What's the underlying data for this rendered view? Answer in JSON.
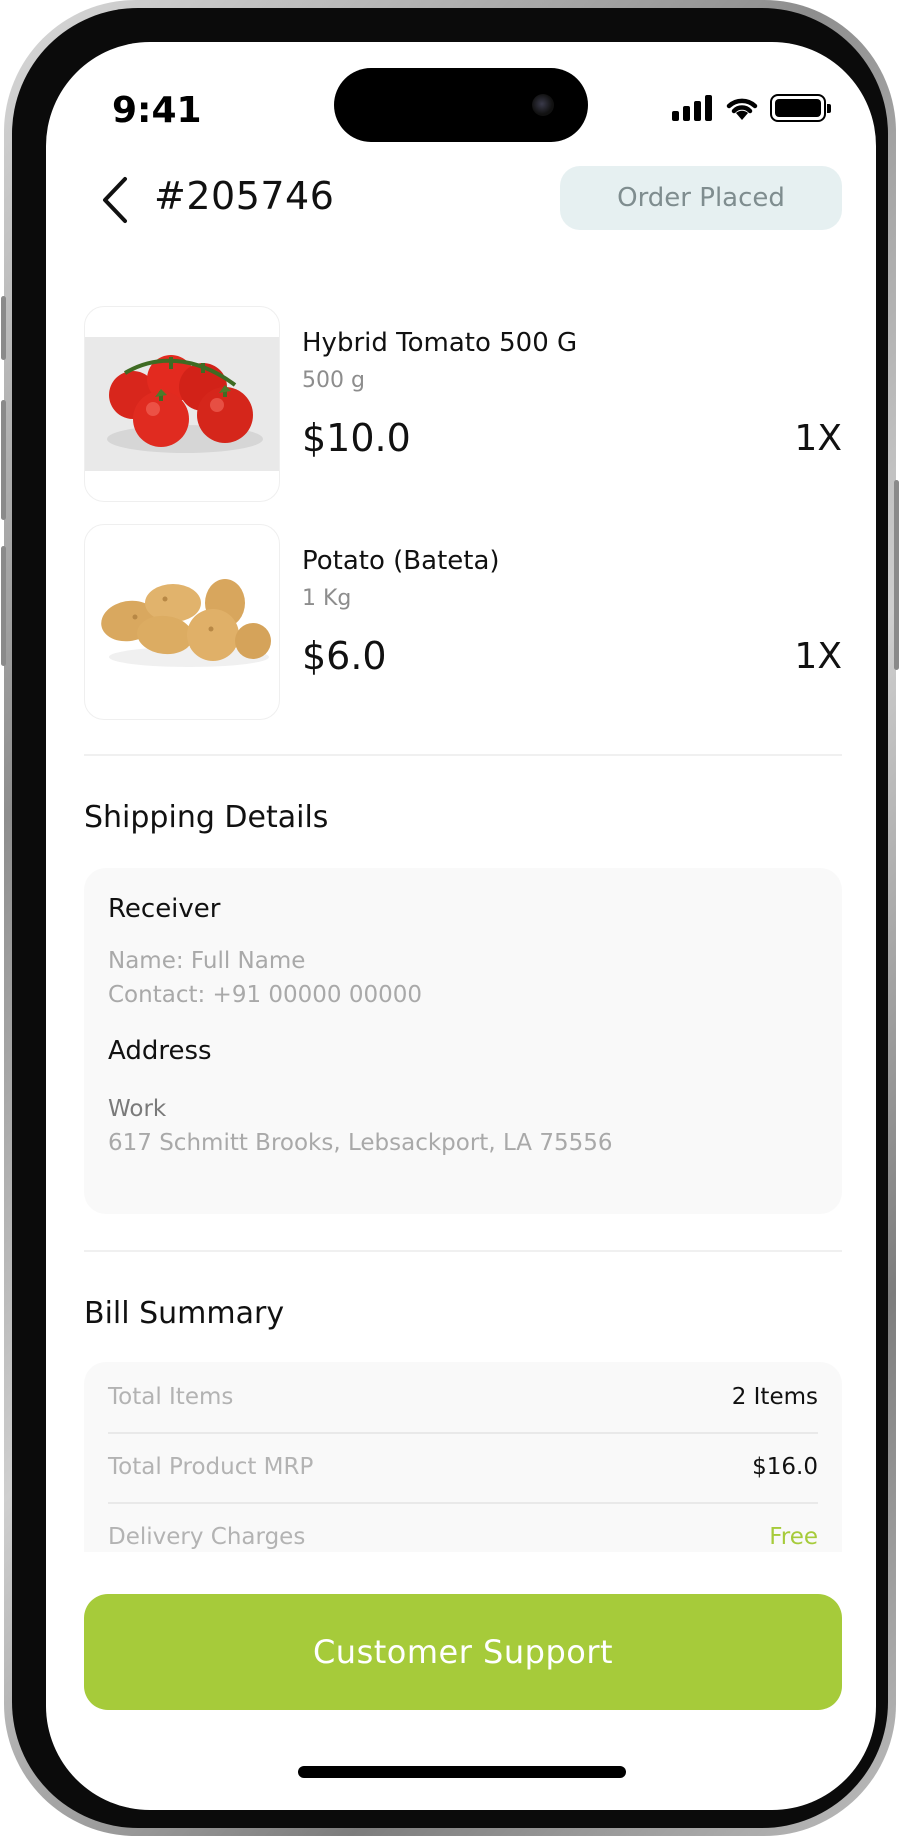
{
  "status_bar": {
    "time": "9:41",
    "icons": [
      "signal-icon",
      "wifi-icon",
      "battery-icon"
    ]
  },
  "header": {
    "back_icon": "chevron-left-icon",
    "order_id": "#205746",
    "status": "Order Placed"
  },
  "products": [
    {
      "name": "Hybrid Tomato 500 G",
      "unit": "500 g",
      "price": "$10.0",
      "qty": "1X",
      "image": "tomato-image"
    },
    {
      "name": "Potato (Bateta)",
      "unit": "1 Kg",
      "price": "$6.0",
      "qty": "1X",
      "image": "potato-image"
    }
  ],
  "shipping": {
    "title": "Shipping Details",
    "receiver_label": "Receiver",
    "receiver_name": "Name: Full Name",
    "receiver_contact": "Contact: +91 00000 00000",
    "address_label": "Address",
    "address_type": "Work",
    "address_line": "617 Schmitt Brooks, Lebsackport, LA 75556"
  },
  "bill": {
    "title": "Bill Summary",
    "rows": [
      {
        "label": "Total Items",
        "value": "2 Items"
      },
      {
        "label": "Total Product MRP",
        "value": "$16.0"
      },
      {
        "label": "Delivery Charges",
        "value": "Free"
      }
    ]
  },
  "cta": {
    "label": "Customer Support"
  },
  "colors": {
    "accent": "#a6cb3a",
    "status_pill_bg": "#e6f0f1",
    "status_pill_text": "#7f8d8f",
    "card_bg": "#f9f9f9"
  }
}
